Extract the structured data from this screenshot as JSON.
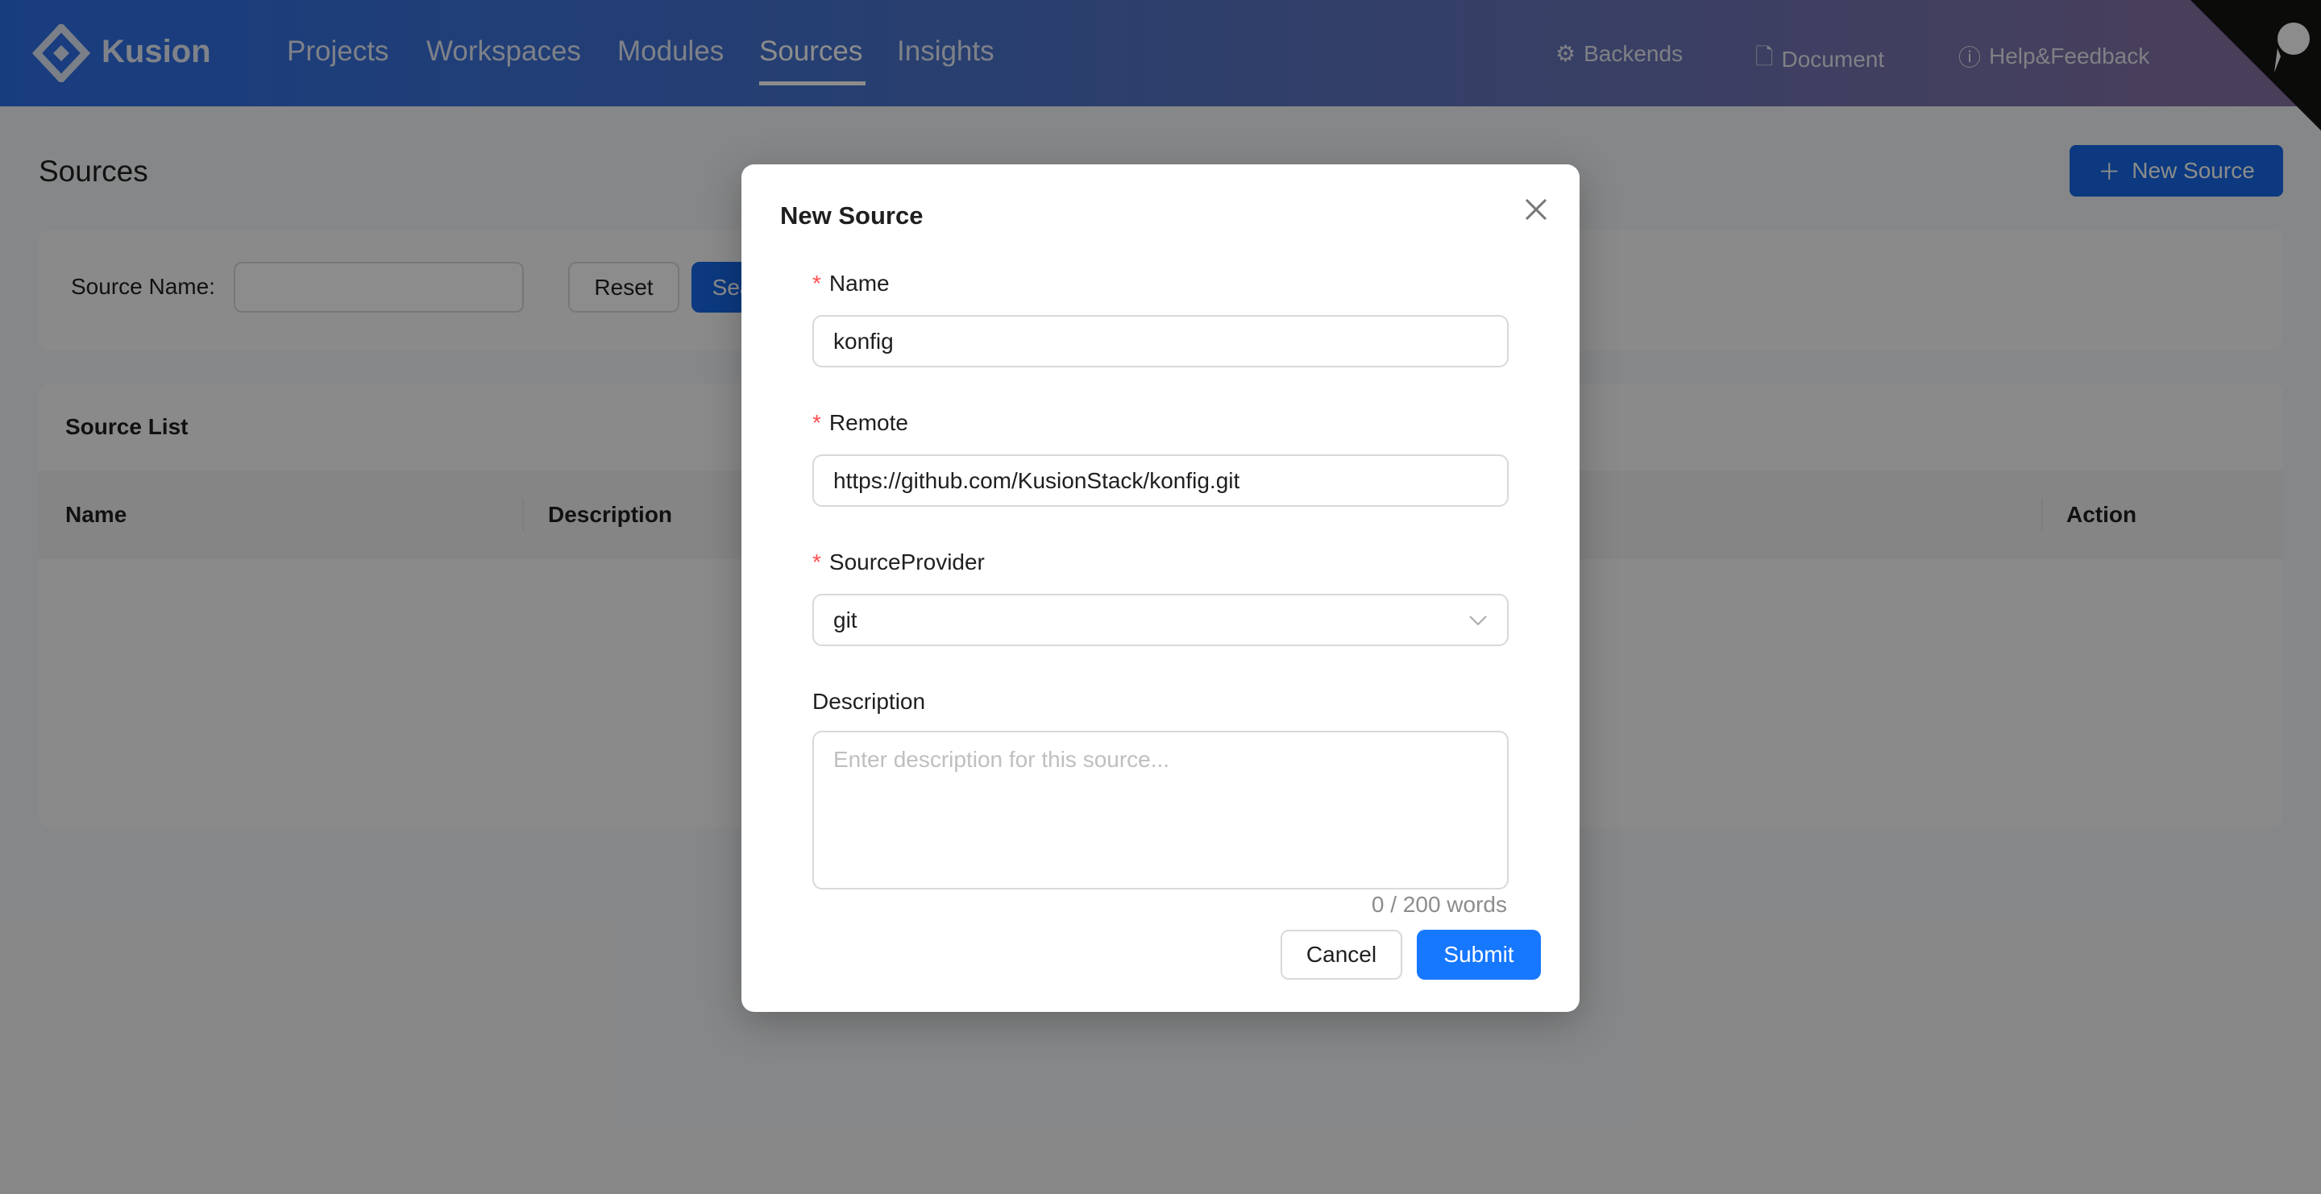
{
  "header": {
    "brand": "Kusion",
    "nav": [
      "Projects",
      "Workspaces",
      "Modules",
      "Sources",
      "Insights"
    ],
    "active_nav": "Sources",
    "tools": {
      "backends": "Backends",
      "document": "Document",
      "help": "Help&Feedback"
    }
  },
  "page": {
    "title": "Sources",
    "new_button": "New Source"
  },
  "filter": {
    "source_name_label": "Source Name:",
    "source_name_value": "",
    "reset": "Reset",
    "search": "Search"
  },
  "list": {
    "title": "Source List",
    "columns": [
      "Name",
      "Description",
      "Action"
    ]
  },
  "modal": {
    "title": "New Source",
    "name_label": "Name",
    "name_value": "konfig",
    "remote_label": "Remote",
    "remote_value": "https://github.com/KusionStack/konfig.git",
    "provider_label": "SourceProvider",
    "provider_value": "git",
    "description_label": "Description",
    "description_placeholder": "Enter description for this source...",
    "counter": "0 / 200 words",
    "cancel": "Cancel",
    "submit": "Submit"
  },
  "colors": {
    "primary": "#1677ff",
    "required": "#ff4d4f"
  }
}
